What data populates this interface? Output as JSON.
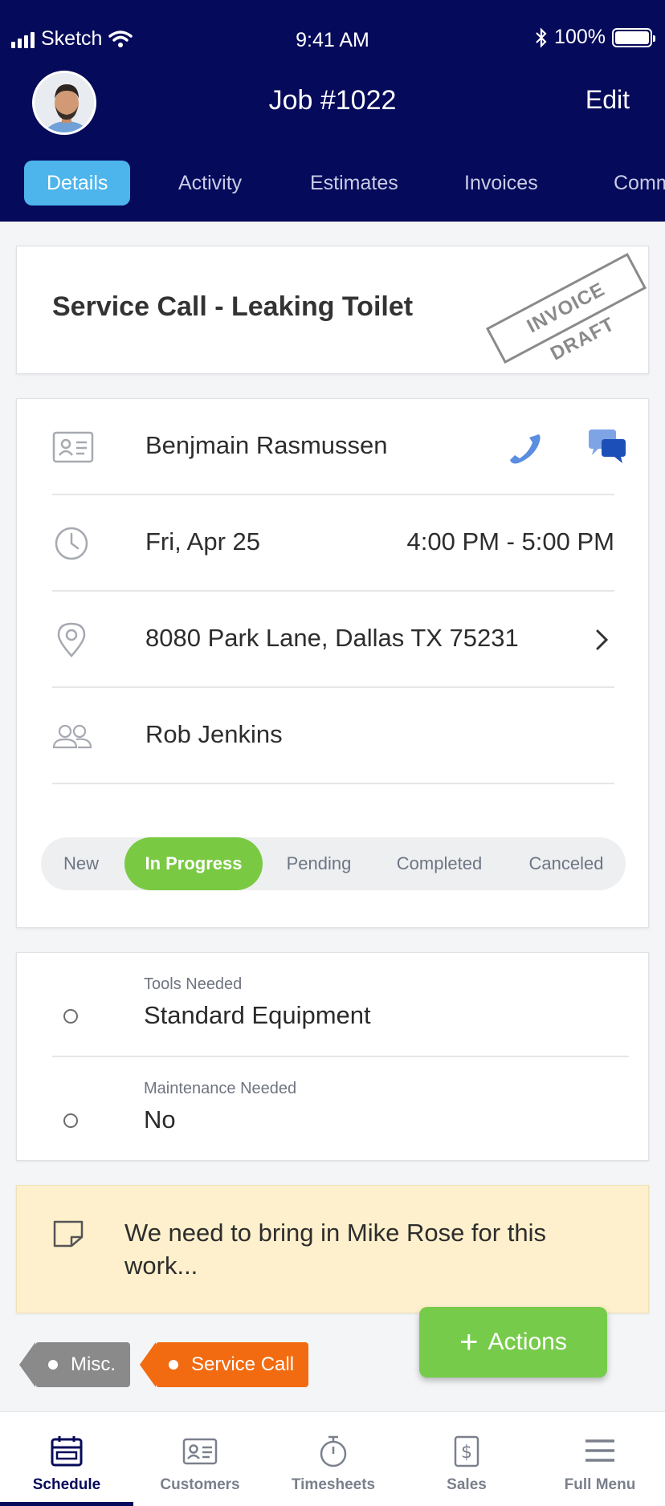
{
  "status_bar": {
    "carrier": "Sketch",
    "time": "9:41 AM",
    "battery": "100%"
  },
  "header": {
    "title": "Job #1022",
    "edit_label": "Edit",
    "tabs": [
      {
        "label": "Details",
        "active": true
      },
      {
        "label": "Activity",
        "active": false
      },
      {
        "label": "Estimates",
        "active": false
      },
      {
        "label": "Invoices",
        "active": false
      },
      {
        "label": "Comm",
        "active": false
      }
    ]
  },
  "job": {
    "title": "Service Call - Leaking Toilet",
    "stamp": "INVOICE DRAFT",
    "customer": "Benjmain Rasmussen",
    "date": "Fri, Apr 25",
    "time_range": "4:00 PM - 5:00 PM",
    "address": "8080 Park Lane, Dallas TX 75231",
    "assignee": "Rob Jenkins",
    "statuses": [
      {
        "label": "New",
        "active": false
      },
      {
        "label": "In Progress",
        "active": true
      },
      {
        "label": "Pending",
        "active": false
      },
      {
        "label": "Completed",
        "active": false
      },
      {
        "label": "Canceled",
        "active": false
      }
    ]
  },
  "fields": [
    {
      "label": "Tools Needed",
      "value": "Standard Equipment"
    },
    {
      "label": "Maintenance Needed",
      "value": "No"
    }
  ],
  "note": {
    "text": "We need to bring in Mike Rose for this work..."
  },
  "tags": [
    {
      "label": "Misc.",
      "color": "#8a8a8a"
    },
    {
      "label": "Service Call",
      "color": "#f26b11"
    }
  ],
  "actions_button": {
    "label": "Actions"
  },
  "bottom_nav": [
    {
      "label": "Schedule",
      "icon": "calendar-icon",
      "active": true
    },
    {
      "label": "Customers",
      "icon": "contact-card-icon",
      "active": false
    },
    {
      "label": "Timesheets",
      "icon": "stopwatch-icon",
      "active": false
    },
    {
      "label": "Sales",
      "icon": "dollar-icon",
      "active": false
    },
    {
      "label": "Full Menu",
      "icon": "hamburger-icon",
      "active": false
    }
  ],
  "colors": {
    "header_bg": "#050a5a",
    "active_tab": "#4db5ec",
    "status_active": "#7ac943",
    "note_bg": "#fef0cc",
    "fab": "#76cc4a",
    "tag_service": "#f26b11"
  }
}
